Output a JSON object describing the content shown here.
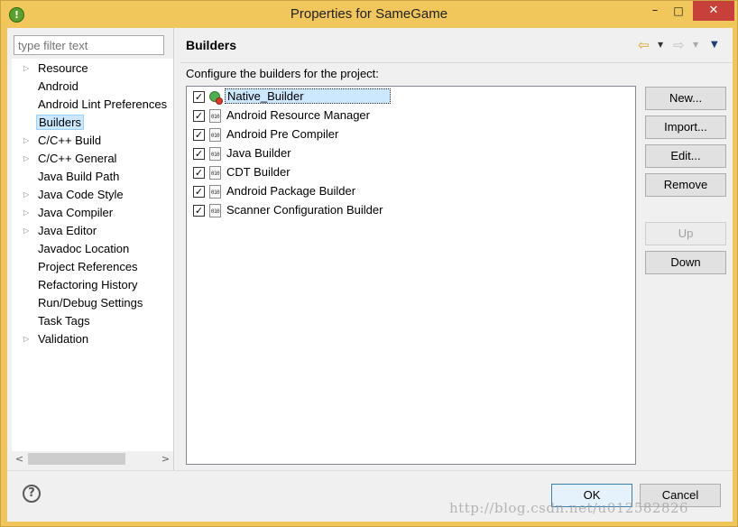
{
  "window": {
    "title": "Properties for SameGame",
    "app_icon_glyph": "!",
    "controls": {
      "minimize": "–",
      "maximize": "□",
      "close": "✕"
    }
  },
  "sidebar": {
    "filter_placeholder": "type filter text",
    "items": [
      {
        "label": "Resource",
        "expandable": true
      },
      {
        "label": "Android",
        "expandable": false
      },
      {
        "label": "Android Lint Preferences",
        "expandable": false
      },
      {
        "label": "Builders",
        "expandable": false,
        "selected": true
      },
      {
        "label": "C/C++ Build",
        "expandable": true
      },
      {
        "label": "C/C++ General",
        "expandable": true
      },
      {
        "label": "Java Build Path",
        "expandable": false
      },
      {
        "label": "Java Code Style",
        "expandable": true
      },
      {
        "label": "Java Compiler",
        "expandable": true
      },
      {
        "label": "Java Editor",
        "expandable": true
      },
      {
        "label": "Javadoc Location",
        "expandable": false
      },
      {
        "label": "Project References",
        "expandable": false
      },
      {
        "label": "Refactoring History",
        "expandable": false
      },
      {
        "label": "Run/Debug Settings",
        "expandable": false
      },
      {
        "label": "Task Tags",
        "expandable": false
      },
      {
        "label": "Validation",
        "expandable": true
      }
    ]
  },
  "main": {
    "title": "Builders",
    "description": "Configure the builders for the project:",
    "builders": [
      {
        "label": "Native_Builder",
        "checked": true,
        "icon": "native-builder-icon",
        "selected": true
      },
      {
        "label": "Android Resource Manager",
        "checked": true,
        "icon": "binary-builder-icon"
      },
      {
        "label": "Android Pre Compiler",
        "checked": true,
        "icon": "binary-builder-icon"
      },
      {
        "label": "Java Builder",
        "checked": true,
        "icon": "binary-builder-icon"
      },
      {
        "label": "CDT Builder",
        "checked": true,
        "icon": "binary-builder-icon"
      },
      {
        "label": "Android Package Builder",
        "checked": true,
        "icon": "binary-builder-icon"
      },
      {
        "label": "Scanner Configuration Builder",
        "checked": true,
        "icon": "binary-builder-icon"
      }
    ],
    "buttons": {
      "new": "New...",
      "import": "Import...",
      "edit": "Edit...",
      "remove": "Remove",
      "up": "Up",
      "down": "Down"
    }
  },
  "footer": {
    "ok": "OK",
    "cancel": "Cancel",
    "help_glyph": "?"
  },
  "watermark": "http://blog.csdn.net/u012582826",
  "colors": {
    "title_bar": "#f1c75c",
    "close_button": "#c7413a",
    "selection": "#cce8ff",
    "ok_border": "#3c7fb1"
  }
}
